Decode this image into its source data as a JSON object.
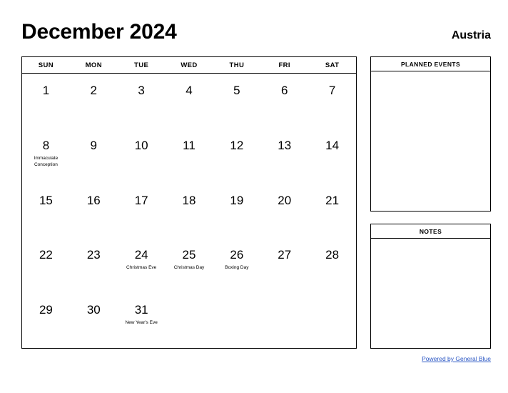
{
  "header": {
    "title": "December 2024",
    "region": "Austria"
  },
  "calendar": {
    "weekdays": [
      "SUN",
      "MON",
      "TUE",
      "WED",
      "THU",
      "FRI",
      "SAT"
    ],
    "weeks": [
      [
        {
          "day": "1",
          "event": ""
        },
        {
          "day": "2",
          "event": ""
        },
        {
          "day": "3",
          "event": ""
        },
        {
          "day": "4",
          "event": ""
        },
        {
          "day": "5",
          "event": ""
        },
        {
          "day": "6",
          "event": ""
        },
        {
          "day": "7",
          "event": ""
        }
      ],
      [
        {
          "day": "8",
          "event": "Immaculate Conception"
        },
        {
          "day": "9",
          "event": ""
        },
        {
          "day": "10",
          "event": ""
        },
        {
          "day": "11",
          "event": ""
        },
        {
          "day": "12",
          "event": ""
        },
        {
          "day": "13",
          "event": ""
        },
        {
          "day": "14",
          "event": ""
        }
      ],
      [
        {
          "day": "15",
          "event": ""
        },
        {
          "day": "16",
          "event": ""
        },
        {
          "day": "17",
          "event": ""
        },
        {
          "day": "18",
          "event": ""
        },
        {
          "day": "19",
          "event": ""
        },
        {
          "day": "20",
          "event": ""
        },
        {
          "day": "21",
          "event": ""
        }
      ],
      [
        {
          "day": "22",
          "event": ""
        },
        {
          "day": "23",
          "event": ""
        },
        {
          "day": "24",
          "event": "Christmas Eve"
        },
        {
          "day": "25",
          "event": "Christmas Day"
        },
        {
          "day": "26",
          "event": "Boxing Day"
        },
        {
          "day": "27",
          "event": ""
        },
        {
          "day": "28",
          "event": ""
        }
      ],
      [
        {
          "day": "29",
          "event": ""
        },
        {
          "day": "30",
          "event": ""
        },
        {
          "day": "31",
          "event": "New Year's Eve"
        },
        {
          "day": "",
          "event": ""
        },
        {
          "day": "",
          "event": ""
        },
        {
          "day": "",
          "event": ""
        },
        {
          "day": "",
          "event": ""
        }
      ]
    ]
  },
  "panels": {
    "planned_events_title": "PLANNED EVENTS",
    "notes_title": "NOTES"
  },
  "footer": {
    "link_text": "Powered by General Blue",
    "link_color": "#2b57c4"
  }
}
